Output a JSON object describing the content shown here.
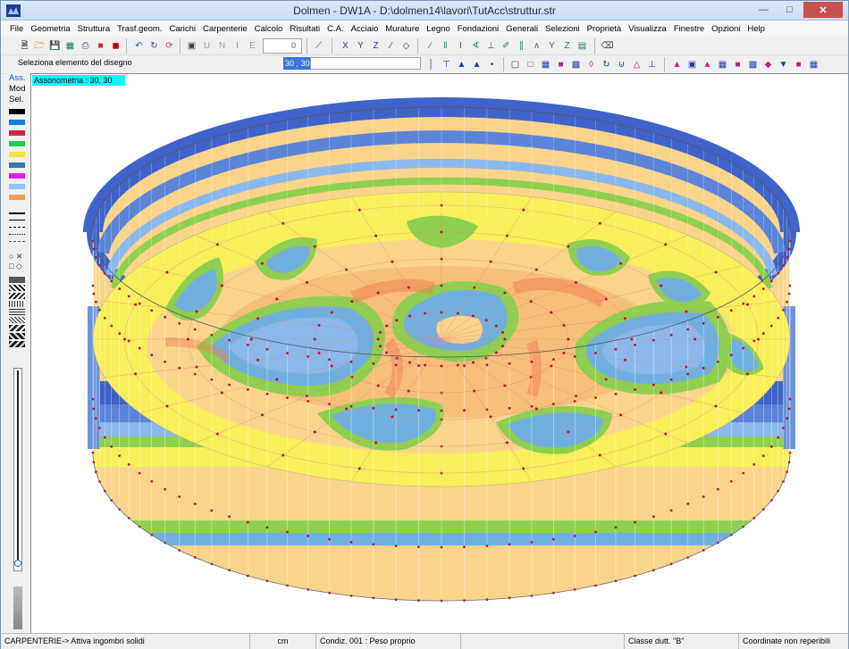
{
  "window": {
    "title": "Dolmen - DW1A - D:\\dolmen14\\lavori\\TutAcc\\struttur.str"
  },
  "menu": [
    "File",
    "Geometria",
    "Struttura",
    "Trasf.geom.",
    "Carichi",
    "Carpenterie",
    "Calcolo",
    "Risultati",
    "C.A.",
    "Acciaio",
    "Murature",
    "Legno",
    "Fondazioni",
    "Generali",
    "Selezioni",
    "Proprietà",
    "Visualizza",
    "Finestre",
    "Opzioni",
    "Help"
  ],
  "toolbar": {
    "level_value": "0",
    "prompt": "Seleziona  elemento del disegno",
    "angle_value": "30 , 30"
  },
  "sidebar": {
    "tabs": [
      "Ass.",
      "Mod",
      "Sel."
    ],
    "palette": [
      "#000000",
      "#1a7ae0",
      "#c8284a",
      "#28c850",
      "#f0e040",
      "#3a7aa0",
      "#e020e0",
      "#98c0f0",
      "#f0a050"
    ]
  },
  "canvas": {
    "view_label": "Assonometria :  30, 30",
    "colors": {
      "deep_blue": "#3f63c8",
      "blue": "#5b84d8",
      "light_blue": "#8ab8ec",
      "cyan_blue": "#6fb0e0",
      "green": "#8ecf50",
      "yellow": "#f7ef5a",
      "light_orange": "#fbd48c",
      "orange": "#f7b070",
      "red_orange": "#ee8050",
      "node": "#b81830"
    }
  },
  "status": {
    "message": "CARPENTERIE-> Attiva ingombri solidi",
    "units": "cm",
    "condition": "Condiz. 001 : Peso proprio",
    "ductility": "Classe dutt. \"B\"",
    "coords": "Coordinate non reperibili"
  }
}
